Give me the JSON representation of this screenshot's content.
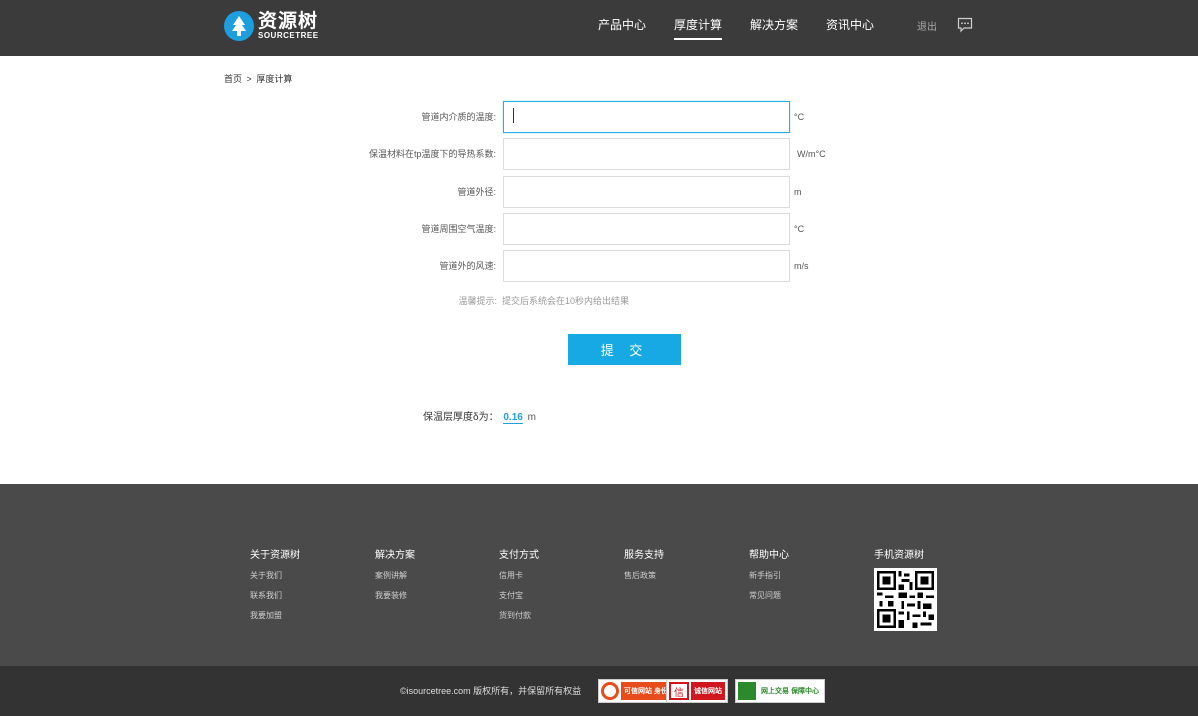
{
  "header": {
    "logo_cn": "资源树",
    "logo_en": "SOURCETREE",
    "nav": [
      {
        "label": "产品中心"
      },
      {
        "label": "厚度计算"
      },
      {
        "label": "解决方案"
      },
      {
        "label": "资讯中心"
      }
    ],
    "logout": "退出",
    "icons": {
      "logo": "tree-icon",
      "message": "message-icon"
    }
  },
  "breadcrumb": {
    "home": "首页",
    "separator": ">",
    "current": "厚度计算"
  },
  "form": {
    "fields": [
      {
        "label": "管道内介质的温度:",
        "value": "",
        "unit": "°C"
      },
      {
        "label": "保温材料在tp温度下的导热系数:",
        "value": "",
        "unit": "W/m°C"
      },
      {
        "label": "管道外径:",
        "value": "",
        "unit": "m"
      },
      {
        "label": "管道周围空气温度:",
        "value": "",
        "unit": "°C"
      },
      {
        "label": "管道外的风速:",
        "value": "",
        "unit": "m/s"
      }
    ],
    "tip_label": "温馨提示:",
    "tip_text": "提交后系统会在10秒内给出结果",
    "submit_label": "提 交"
  },
  "result": {
    "label": "保温层厚度δ为：",
    "value": "0.16",
    "unit": "m"
  },
  "footer": {
    "columns": [
      {
        "title": "关于资源树",
        "links": [
          "关于我们",
          "联系我们",
          "我要加盟"
        ]
      },
      {
        "title": "解决方案",
        "links": [
          "案例讲解",
          "我要装修"
        ]
      },
      {
        "title": "支付方式",
        "links": [
          "信用卡",
          "支付宝",
          "货到付款"
        ]
      },
      {
        "title": "服务支持",
        "links": [
          "售后政策"
        ]
      },
      {
        "title": "帮助中心",
        "links": [
          "新手指引",
          "常见问题"
        ]
      },
      {
        "title": "手机资源树",
        "links": []
      }
    ],
    "copyright": "©isourcetree.com 版权所有，并保留所有权益",
    "badges": [
      {
        "text": "可信网站 身份验证",
        "color": "#e84b1c"
      },
      {
        "text": "诚信网站",
        "color": "#d0161f"
      },
      {
        "text": "网上交易 保障中心",
        "color": "#2b8a2b"
      }
    ]
  },
  "colors": {
    "accent": "#16a9e4",
    "header_bg": "#3b3b3b",
    "footer_bg": "#4a4a4a"
  }
}
